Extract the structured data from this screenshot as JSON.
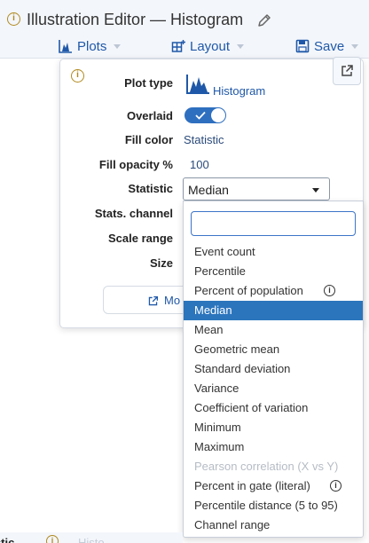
{
  "header": {
    "title": "Illustration Editor — Histogram",
    "info_icon": "info-icon",
    "edit_icon": "pencil-icon"
  },
  "toolbar": {
    "plots_label": "Plots",
    "layout_label": "Layout",
    "save_label": "Save"
  },
  "panel": {
    "plot_type_label": "Plot type",
    "plot_type_value": "Histogram",
    "overlaid_label": "Overlaid",
    "overlaid_on": true,
    "fill_color_label": "Fill color",
    "fill_color_value": "Statistic",
    "fill_opacity_label": "Fill opacity %",
    "fill_opacity_value": "100",
    "statistic_label": "Statistic",
    "statistic_value": "Median",
    "stats_channel_label": "Stats. channel",
    "scale_range_label": "Scale range",
    "size_label": "Size",
    "more_button_label": "Mo"
  },
  "dropdown": {
    "search_placeholder": "",
    "options": [
      {
        "label": "Event count",
        "selected": false,
        "disabled": false,
        "info": false
      },
      {
        "label": "Percentile",
        "selected": false,
        "disabled": false,
        "info": false
      },
      {
        "label": "Percent of population",
        "selected": false,
        "disabled": false,
        "info": true
      },
      {
        "label": "Median",
        "selected": true,
        "disabled": false,
        "info": false
      },
      {
        "label": "Mean",
        "selected": false,
        "disabled": false,
        "info": false
      },
      {
        "label": "Geometric mean",
        "selected": false,
        "disabled": false,
        "info": false
      },
      {
        "label": "Standard deviation",
        "selected": false,
        "disabled": false,
        "info": false
      },
      {
        "label": "Variance",
        "selected": false,
        "disabled": false,
        "info": false
      },
      {
        "label": "Coefficient of variation",
        "selected": false,
        "disabled": false,
        "info": false
      },
      {
        "label": "Minimum",
        "selected": false,
        "disabled": false,
        "info": false
      },
      {
        "label": "Maximum",
        "selected": false,
        "disabled": false,
        "info": false
      },
      {
        "label": "Pearson correlation (X vs Y)",
        "selected": false,
        "disabled": true,
        "info": false
      },
      {
        "label": "Percent in gate (literal)",
        "selected": false,
        "disabled": false,
        "info": true
      },
      {
        "label": "Percentile distance (5 to 95)",
        "selected": false,
        "disabled": false,
        "info": false
      },
      {
        "label": "Channel range",
        "selected": false,
        "disabled": false,
        "info": false
      }
    ]
  },
  "bottom_row": {
    "label": "tistic",
    "hint": "Histo"
  },
  "colors": {
    "accent": "#1f58a8",
    "selected_bg": "#2b75bd",
    "info_icon": "#b08a1e",
    "toggle_on": "#2e6fc0"
  }
}
